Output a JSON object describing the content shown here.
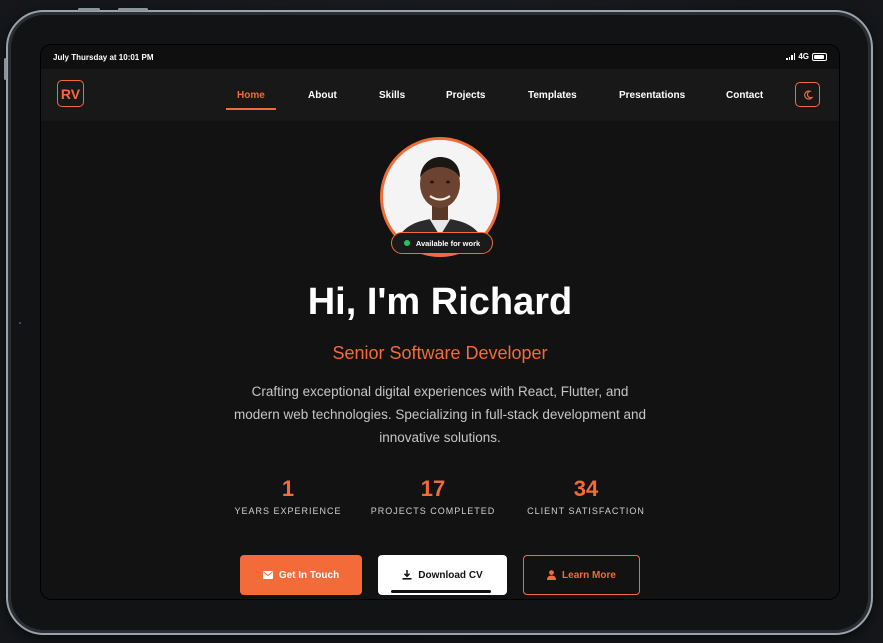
{
  "statusbar": {
    "time": "July Thursday at 10:01 PM",
    "network": "4G"
  },
  "nav": {
    "logo": "RV",
    "items": [
      "Home",
      "About",
      "Skills",
      "Projects",
      "Templates",
      "Presentations",
      "Contact"
    ],
    "active": "Home",
    "theme_icon": "moon-icon"
  },
  "hero": {
    "availability": "Available for work",
    "title": "Hi, I'm Richard",
    "subtitle": "Senior Software Developer",
    "description": "Crafting exceptional digital experiences with React, Flutter, and modern web technologies. Specializing in full-stack development and innovative solutions.",
    "stats": [
      {
        "value": "1",
        "label": "YEARS EXPERIENCE"
      },
      {
        "value": "17",
        "label": "PROJECTS COMPLETED"
      },
      {
        "value": "34",
        "label": "CLIENT SATISFACTION"
      }
    ],
    "buttons": {
      "contact": "Get In Touch",
      "download": "Download CV",
      "learn": "Learn More"
    }
  },
  "colors": {
    "accent": "#f26b38",
    "background": "#121212",
    "available": "#22c55e"
  }
}
